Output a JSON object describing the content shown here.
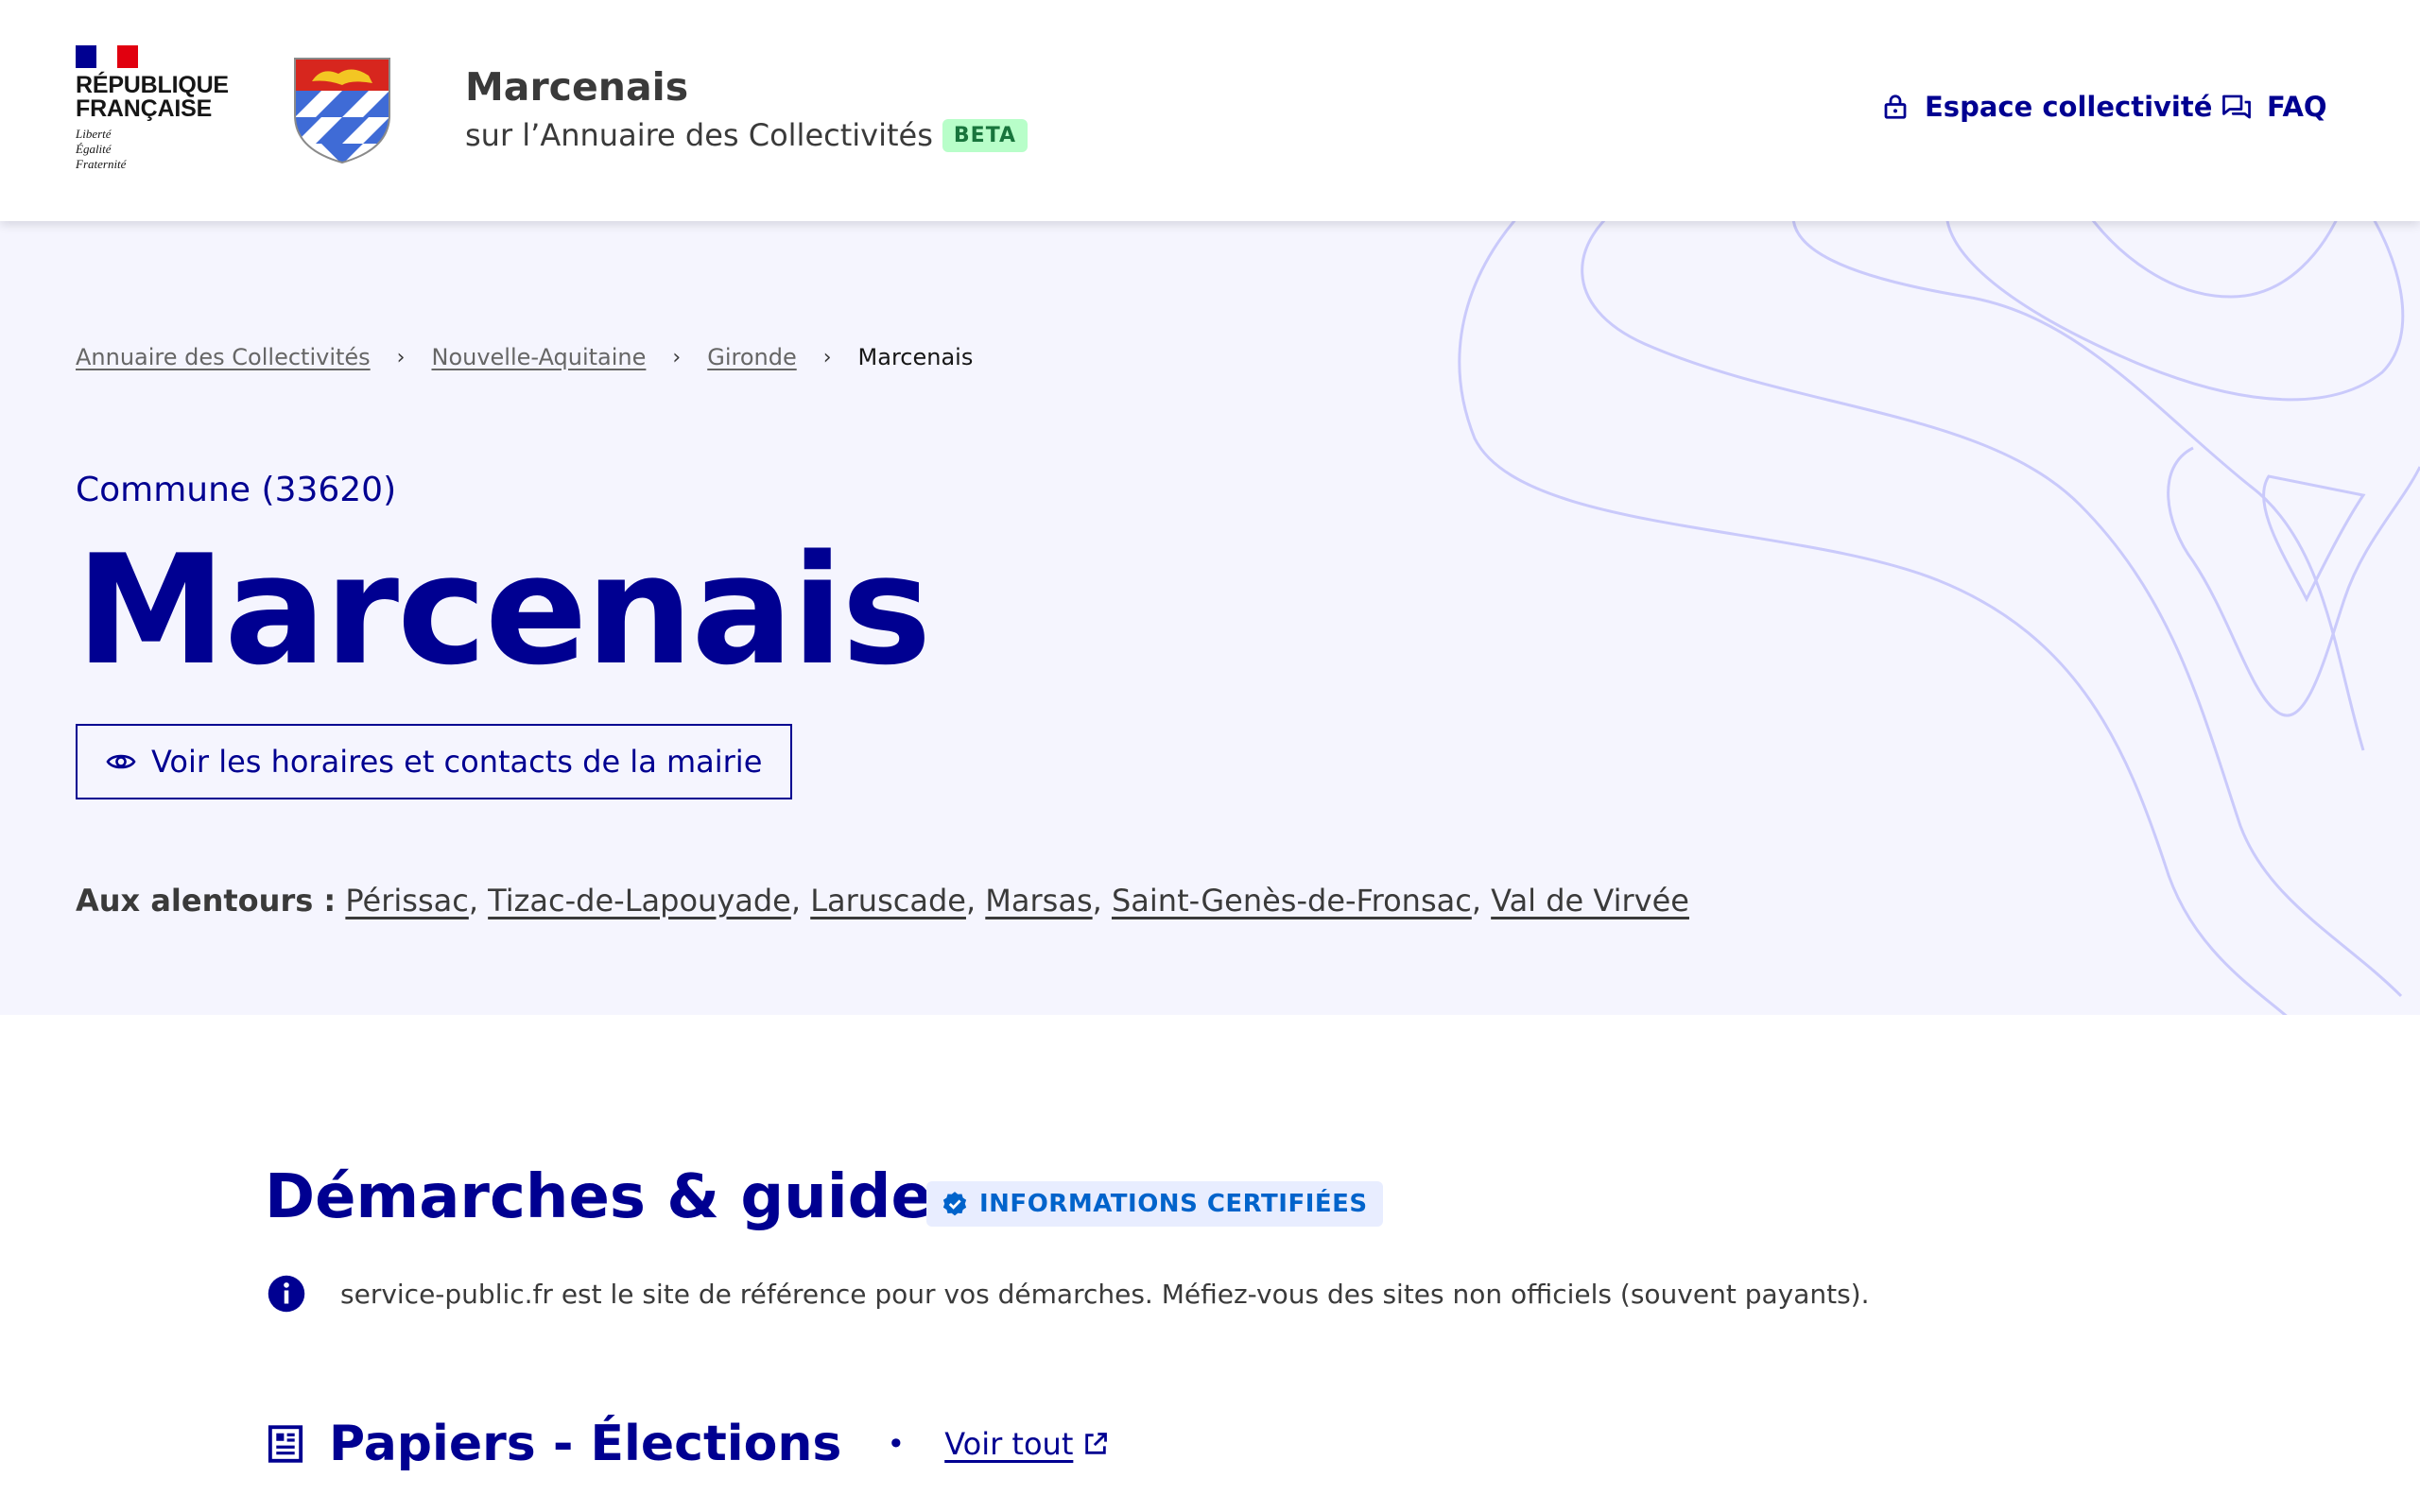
{
  "header": {
    "rf_line1": "RÉPUBLIQUE",
    "rf_line2": "FRANÇAISE",
    "motto": [
      "Liberté",
      "Égalité",
      "Fraternité"
    ],
    "site_name": "Marcenais",
    "site_subtitle": "sur l’Annuaire des Collectivités",
    "beta_badge": "BETA",
    "nav": {
      "espace_label": "Espace collectivité",
      "espace_icon": "lock-icon",
      "faq_label": "FAQ",
      "faq_icon": "chat-icon"
    }
  },
  "breadcrumb": {
    "items": [
      "Annuaire des Collectivités",
      "Nouvelle-Aquitaine",
      "Gironde"
    ],
    "current": "Marcenais"
  },
  "hero": {
    "kind": "Commune (33620)",
    "title": "Marcenais",
    "mairie_button": "Voir les horaires et contacts de la mairie",
    "nearby_label": "Aux alentours :",
    "nearby": [
      "Périssac",
      "Tizac-de-Lapouyade",
      "Laruscade",
      "Marsas",
      "Saint-Genès-de-Fronsac",
      "Val de Virvée"
    ]
  },
  "main": {
    "section_title": "Démarches & guides",
    "certified_badge": "INFORMATIONS CERTIFIÉES",
    "info_text": "service-public.fr est le site de référence pour vos démarches. Méfiez-vous des sites non officiels (souvent payants).",
    "sub_section_title": "Papiers - Élections",
    "see_all": "Voir tout"
  },
  "colors": {
    "primary_blue": "#000091",
    "hero_bg": "#f5f5fe",
    "beta_bg": "#b8fec9",
    "beta_text": "#18753c",
    "badge_bg": "#e8edff",
    "badge_text": "#0063cb",
    "flag_blue": "#000091",
    "flag_red": "#e1000f"
  }
}
